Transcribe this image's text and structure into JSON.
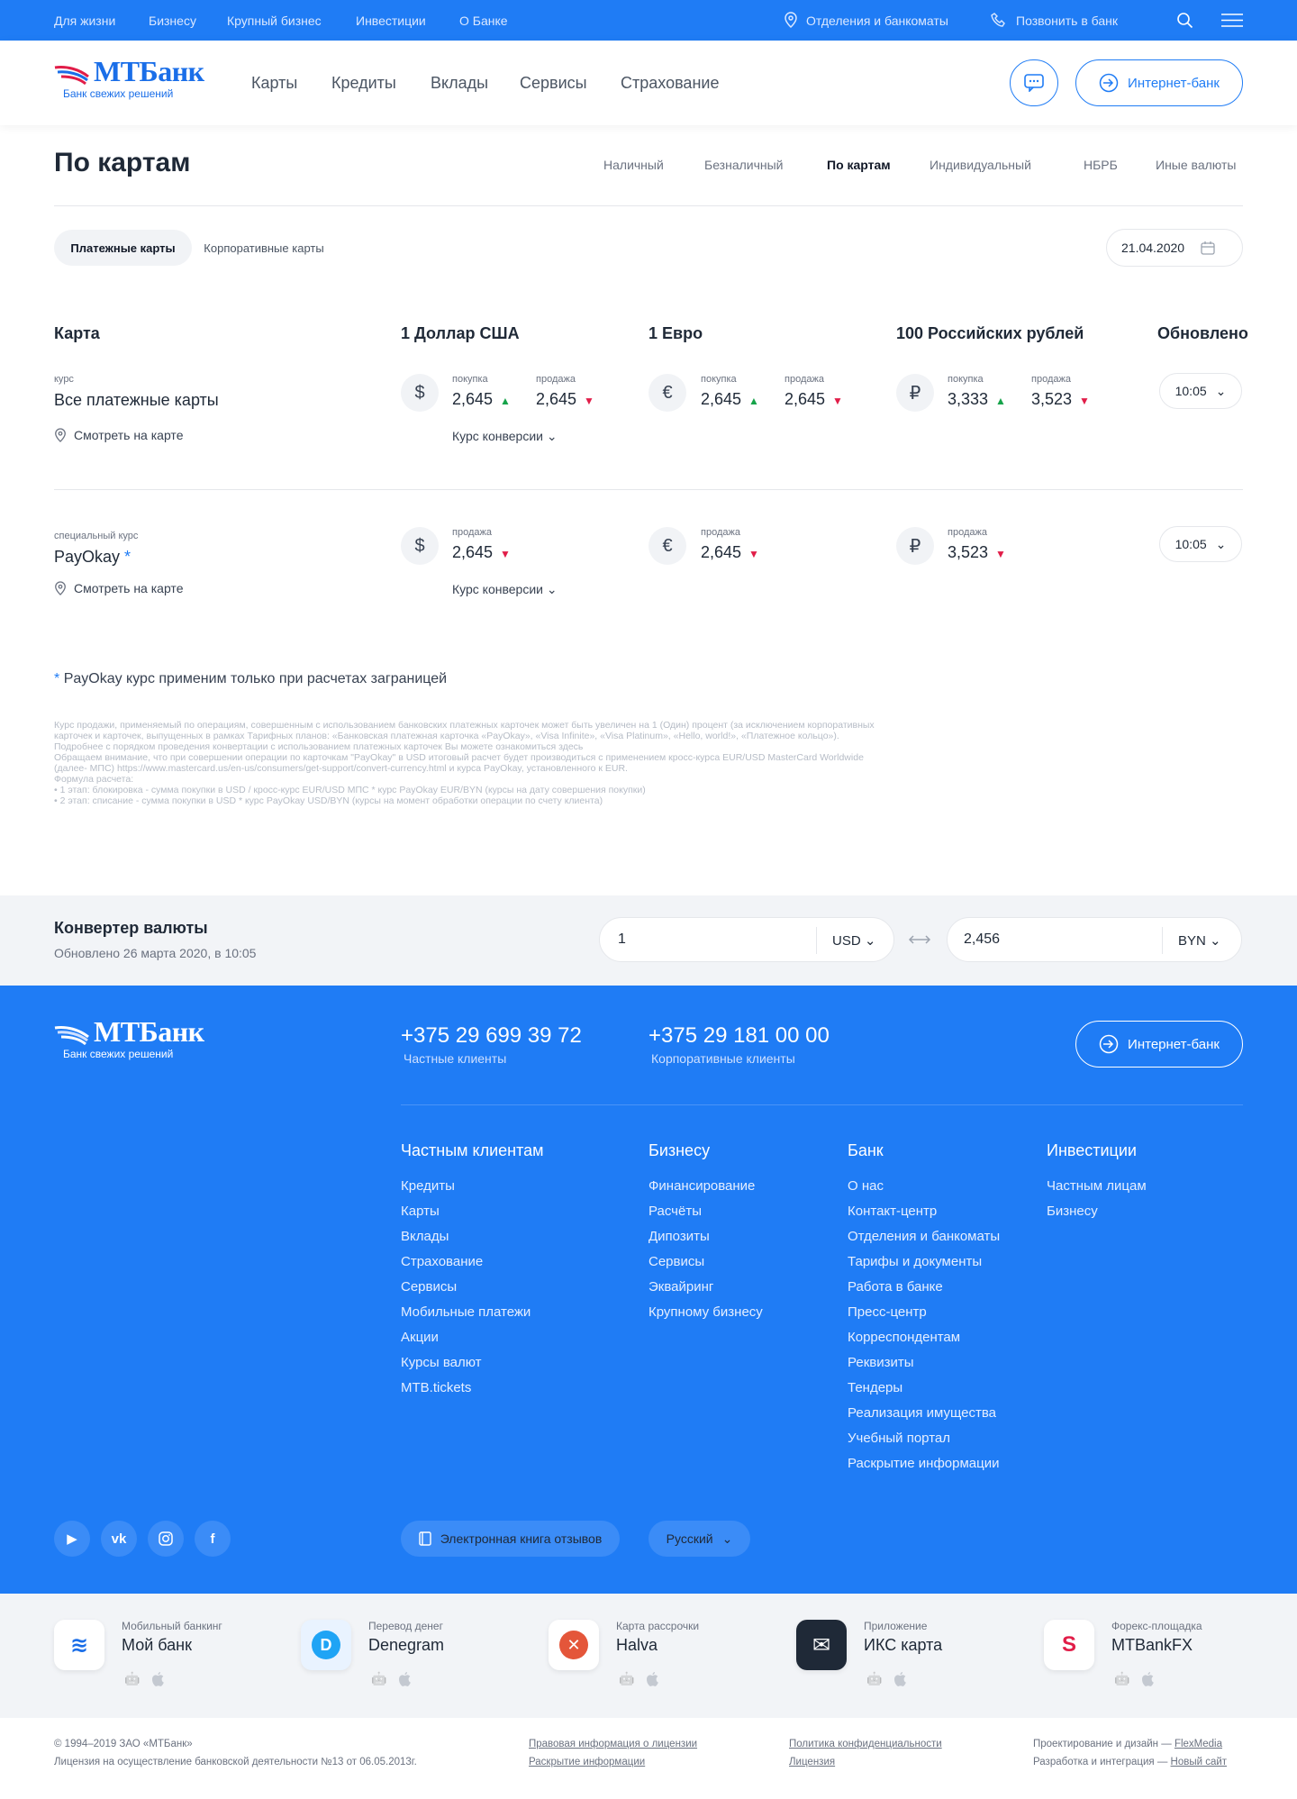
{
  "topbar": {
    "links": [
      "Для жизни",
      "Бизнесу",
      "Крупный бизнес",
      "Инвестиции",
      "О Банке"
    ],
    "branches": "Отделения и банкоматы",
    "call": "Позвонить в банк"
  },
  "brand": {
    "name": "МТБанк",
    "slogan": "Банк свежих решений"
  },
  "nav": [
    "Карты",
    "Кредиты",
    "Вклады",
    "Сервисы",
    "Страхование"
  ],
  "header": {
    "internet_bank": "Интернет-банк"
  },
  "page": {
    "title": "По картам",
    "tabs": [
      "Наличный",
      "Безналичный",
      "По картам",
      "Индивидуальный",
      "НБРБ",
      "Иные валюты"
    ],
    "active_tab": "По картам"
  },
  "filters": {
    "pills": [
      "Платежные карты",
      "Корпоративные карты"
    ],
    "active": "Платежные карты",
    "date": "21.04.2020"
  },
  "table": {
    "headers": [
      "Карта",
      "1 Доллар США",
      "1 Евро",
      "100 Российских рублей",
      "Обновлено"
    ],
    "rows": [
      {
        "label": "курс",
        "title": "Все платежные карты",
        "asterisk": "",
        "usd": {
          "buy_label": "покупка",
          "buy": "2,645",
          "sell_label": "продажа",
          "sell": "2,645"
        },
        "eur": {
          "buy_label": "покупка",
          "buy": "2,645",
          "sell_label": "продажа",
          "sell": "2,645"
        },
        "rub": {
          "buy_label": "покупка",
          "buy": "3,333",
          "sell_label": "продажа",
          "sell": "3,523"
        },
        "updated": "10:05",
        "map": "Смотреть на карте",
        "conversion": "Курс конверсии"
      },
      {
        "label": "специальный курс",
        "title": "PayOkay",
        "asterisk": "*",
        "usd": {
          "sell_label": "продажа",
          "sell": "2,645"
        },
        "eur": {
          "sell_label": "продажа",
          "sell": "2,645"
        },
        "rub": {
          "sell_label": "продажа",
          "sell": "3,523"
        },
        "updated": "10:05",
        "map": "Смотреть на карте",
        "conversion": "Курс конверсии"
      }
    ],
    "currency_symbols": {
      "usd": "$",
      "eur": "€",
      "rub": "₽"
    }
  },
  "note": {
    "star": "*",
    "text": "PayOkay курс применим только при расчетах заграницей"
  },
  "fine_print": [
    "Курс продажи, применяемый по операциям, совершенным с использованием банковских платежных карточек может быть увеличен на 1 (Один) процент (за исключением корпоративных карточек и карточек, выпущенных в рамках Тарифных планов: «Банковская платежная карточка «PayOkay», «Visa Infinite», «Visa Platinum», «Hello, world!», «Платежное кольцо»).",
    "Подробнее с порядком проведения конвертации с использованием платежных карточек Вы можете ознакомиться здесь",
    "Обращаем внимание, что при совершении операции по карточкам \"PayOkay\" в USD итоговый расчет будет производиться с применением кросс-курса EUR/USD MasterCard Worldwide (далее- МПС) https://www.mastercard.us/en-us/consumers/get-support/convert-currency.html и курса PayOkay, установленного к EUR.",
    "Формула расчета:",
    "• 1 этап: блокировка - сумма покупки в USD / кросс-курс EUR/USD МПС * курс PayOkay EUR/BYN (курсы на дату совершения покупки)",
    "• 2 этап: списание - сумма покупки в USD * курс PayOkay USD/BYN (курсы на момент обработки операции по счету клиента)"
  ],
  "converter": {
    "title": "Конвертер валюты",
    "updated": "Обновлено 26 марта 2020, в 10:05",
    "from_amount": "1",
    "from_currency": "USD",
    "to_amount": "2,456",
    "to_currency": "BYN"
  },
  "footer": {
    "phones": [
      {
        "number": "+375 29 699 39 72",
        "label": "Частные клиенты"
      },
      {
        "number": "+375 29 181 00 00",
        "label": "Корпоративные клиенты"
      }
    ],
    "internet_bank": "Интернет-банк",
    "columns": [
      {
        "title": "Частным клиентам",
        "links": [
          "Кредиты",
          "Карты",
          "Вклады",
          "Страхование",
          "Сервисы",
          "Мобильные платежи",
          "Акции",
          "Курсы валют",
          "MTB.tickets"
        ]
      },
      {
        "title": "Бизнесу",
        "links": [
          "Финансирование",
          "Расчёты",
          "Дипозиты",
          "Сервисы",
          "Эквайринг",
          "Крупному бизнесу"
        ]
      },
      {
        "title": "Банк",
        "links": [
          "О нас",
          "Контакт-центр",
          "Отделения и банкоматы",
          "Тарифы и документы",
          "Работа в банке",
          "Пресс-центр",
          "Корреспондентам",
          "Реквизиты",
          "Тендеры",
          "Реализация имущества",
          "Учебный портал",
          "Раскрытие информации"
        ]
      },
      {
        "title": "Инвестиции",
        "links": [
          "Частным лицам",
          "Бизнесу"
        ]
      }
    ],
    "reviews_book": "Электронная книга отзывов",
    "language": "Русский",
    "social": [
      "youtube-icon",
      "vk-icon",
      "instagram-icon",
      "facebook-icon"
    ]
  },
  "apps": [
    {
      "sub": "Мобильный банкинг",
      "name": "Мой банк"
    },
    {
      "sub": "Перевод денег",
      "name": "Denegram"
    },
    {
      "sub": "Карта рассрочки",
      "name": "Halva"
    },
    {
      "sub": "Приложение",
      "name": "ИКС карта"
    },
    {
      "sub": "Форекс-площадка",
      "name": "MTBankFX"
    }
  ],
  "bottom": {
    "copyright": "© 1994–2019 ЗАО «МТБанк»",
    "license": "Лицензия на осуществление банковской деятельности №13 от 06.05.2013г.",
    "legal": "Правовая информация о лицензии",
    "disclosure": "Раскрытие информации",
    "privacy": "Политика конфиденциальности",
    "license_link": "Лицензия",
    "design_prefix": "Проектирование и дизайн —",
    "design_by": "FlexMedia",
    "dev_prefix": "Разработка и интеграция —",
    "dev_by": "Новый сайт"
  },
  "colors": {
    "brand": "#1f7cf5",
    "up": "#16a34a",
    "down": "#e11d48"
  }
}
